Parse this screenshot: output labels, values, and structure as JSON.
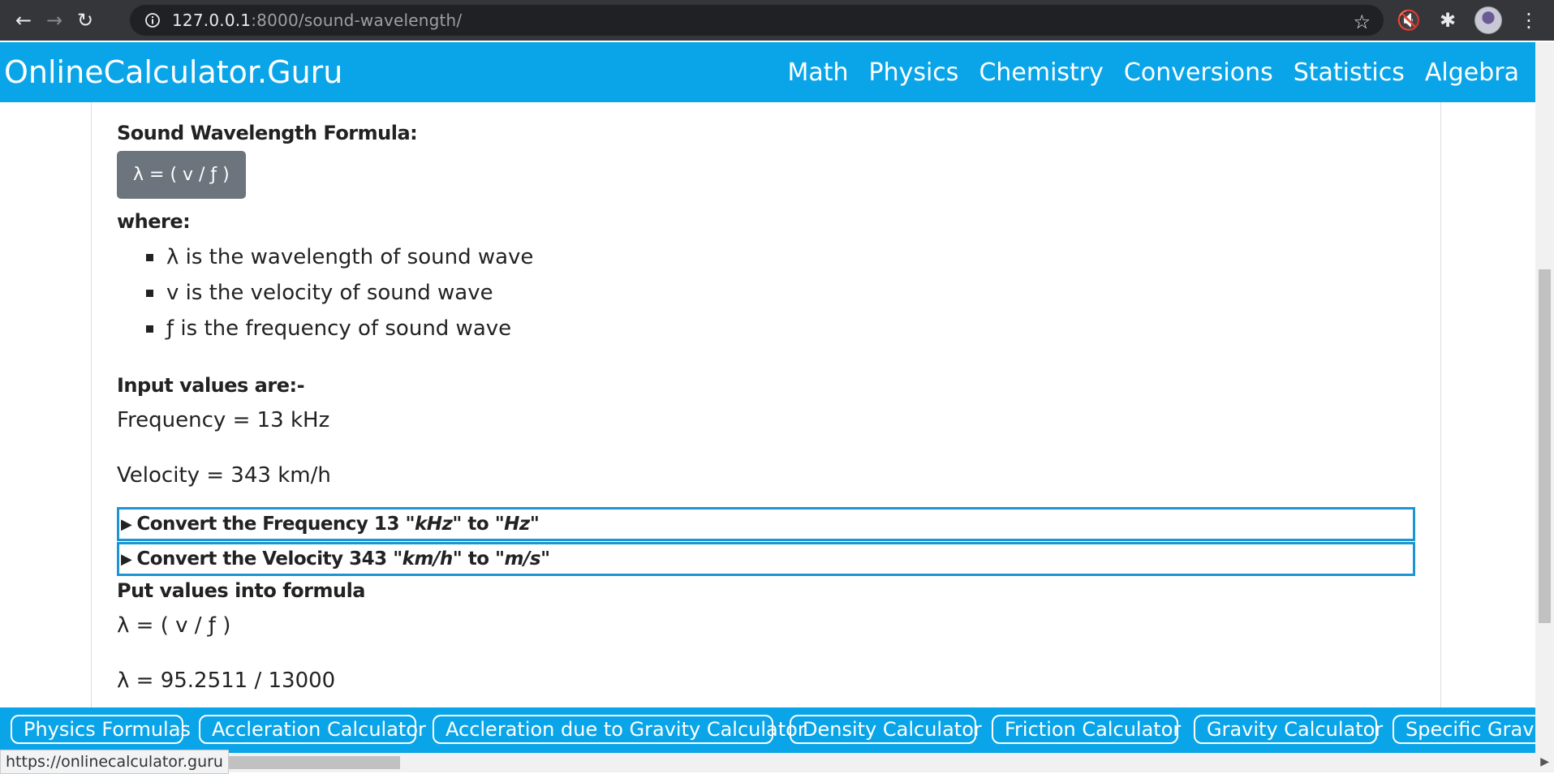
{
  "browser": {
    "url_host": "127.0.0.1",
    "url_path": ":8000/sound-wavelength/",
    "back_icon": "arrow-left-icon",
    "forward_icon": "arrow-right-icon",
    "reload_icon": "reload-icon"
  },
  "site": {
    "brand": "OnlineCalculator.Guru",
    "nav": [
      "Math",
      "Physics",
      "Chemistry",
      "Conversions",
      "Statistics",
      "Algebra"
    ]
  },
  "content": {
    "formula_title": "Sound Wavelength Formula:",
    "formula": "λ = ( v / ƒ )",
    "where_label": "where:",
    "terms": [
      "λ is the wavelength of sound wave",
      "v is the velocity of sound wave",
      "ƒ is the frequency of sound wave"
    ],
    "input_title": "Input values are:-",
    "frequency_line": "Frequency = 13 kHz",
    "velocity_line": "Velocity = 343 km/h",
    "convert1": {
      "prefix": "Convert the Frequency 13",
      "from": "\"kHz\"",
      "mid": "to",
      "to": "\"Hz\""
    },
    "convert2": {
      "prefix": "Convert the Velocity 343",
      "from": "\"km/h\"",
      "mid": "to",
      "to": "\"m/s\""
    },
    "put_title": "Put values into formula",
    "formula_repeat": "λ = ( v / ƒ )",
    "substituted": "λ = 95.2511 / 13000"
  },
  "related": [
    "Physics Formulas",
    "Accleration Calculator",
    "Accleration due to Gravity Calculator",
    "Density Calculator",
    "Friction Calculator",
    "Gravity Calculator",
    "Specific Gravity"
  ],
  "status_url": "https://onlinecalculator.guru"
}
